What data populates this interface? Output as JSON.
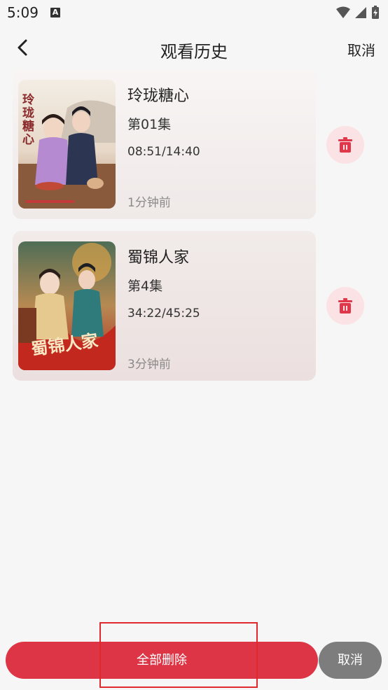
{
  "status_bar": {
    "time": "5:09",
    "notification_icon": "A"
  },
  "nav": {
    "title": "观看历史",
    "cancel_label": "取消"
  },
  "history": [
    {
      "title": "玲珑糖心",
      "episode": "第01集",
      "progress": "08:51/14:40",
      "time_ago": "1分钟前",
      "poster_text": "玲珑糖心",
      "poster_icon": "drama-poster-icon"
    },
    {
      "title": "蜀锦人家",
      "episode": "第4集",
      "progress": "34:22/45:25",
      "time_ago": "3分钟前",
      "poster_text": "蜀锦人家",
      "poster_icon": "drama-poster-icon"
    }
  ],
  "bottom": {
    "delete_all_label": "全部删除",
    "cancel_label": "取消"
  },
  "colors": {
    "accent": "#dd3545",
    "delete_icon": "#e0384a",
    "delete_bg": "#fbe3e5",
    "cancel_bg": "#7d7d7d"
  }
}
